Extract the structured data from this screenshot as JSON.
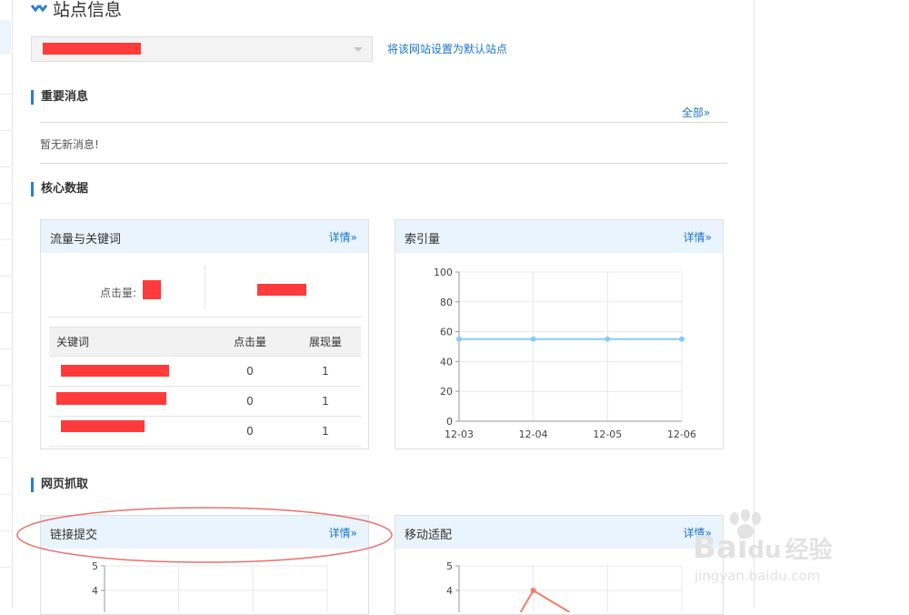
{
  "page_title": "站点信息",
  "site_select": {
    "value": ""
  },
  "set_default_link": "将该网站设置为默认站点",
  "important_msgs": {
    "title": "重要消息",
    "all_link": "全部»",
    "empty_text": "暂无新消息!"
  },
  "core_data": {
    "title": "核心数据",
    "traffic_card": {
      "title": "流量与关键词",
      "details": "详情»",
      "clicks_label": "点击量:",
      "table_headers": [
        "关键词",
        "点击量",
        "展现量"
      ],
      "rows": [
        {
          "keyword": "",
          "clicks": "0",
          "impressions": "1"
        },
        {
          "keyword": "",
          "clicks": "0",
          "impressions": "1"
        },
        {
          "keyword": "",
          "clicks": "0",
          "impressions": "1"
        }
      ]
    },
    "index_card": {
      "title": "索引量",
      "details": "详情»",
      "chart_data": {
        "type": "line",
        "x": [
          "12-03",
          "12-04",
          "12-05",
          "12-06"
        ],
        "series": [
          {
            "values": [
              55,
              55,
              55,
              55
            ]
          }
        ],
        "ylim": [
          0,
          100
        ],
        "yticks": [
          0,
          20,
          40,
          60,
          80,
          100
        ],
        "grid": true,
        "color": "#87cdf2"
      }
    }
  },
  "crawl": {
    "title": "网页抓取",
    "link_submit": {
      "title": "链接提交",
      "details": "详情»",
      "chart_data": {
        "type": "line",
        "yticks_visible": [
          "5",
          "4"
        ],
        "ylim": [
          0,
          5
        ]
      }
    },
    "mobile_adapt": {
      "title": "移动适配",
      "details": "详情»",
      "chart_data": {
        "type": "line",
        "yticks_visible": [
          "5",
          "4"
        ],
        "ylim": [
          0,
          5
        ],
        "visible_points": [
          {
            "x_index": 1,
            "y": 4
          }
        ],
        "color": "#f47c6c"
      }
    }
  },
  "watermark": {
    "brand": "Bai",
    "brand2": "du",
    "text": "经验",
    "url": "jingyan.baidu.com"
  }
}
